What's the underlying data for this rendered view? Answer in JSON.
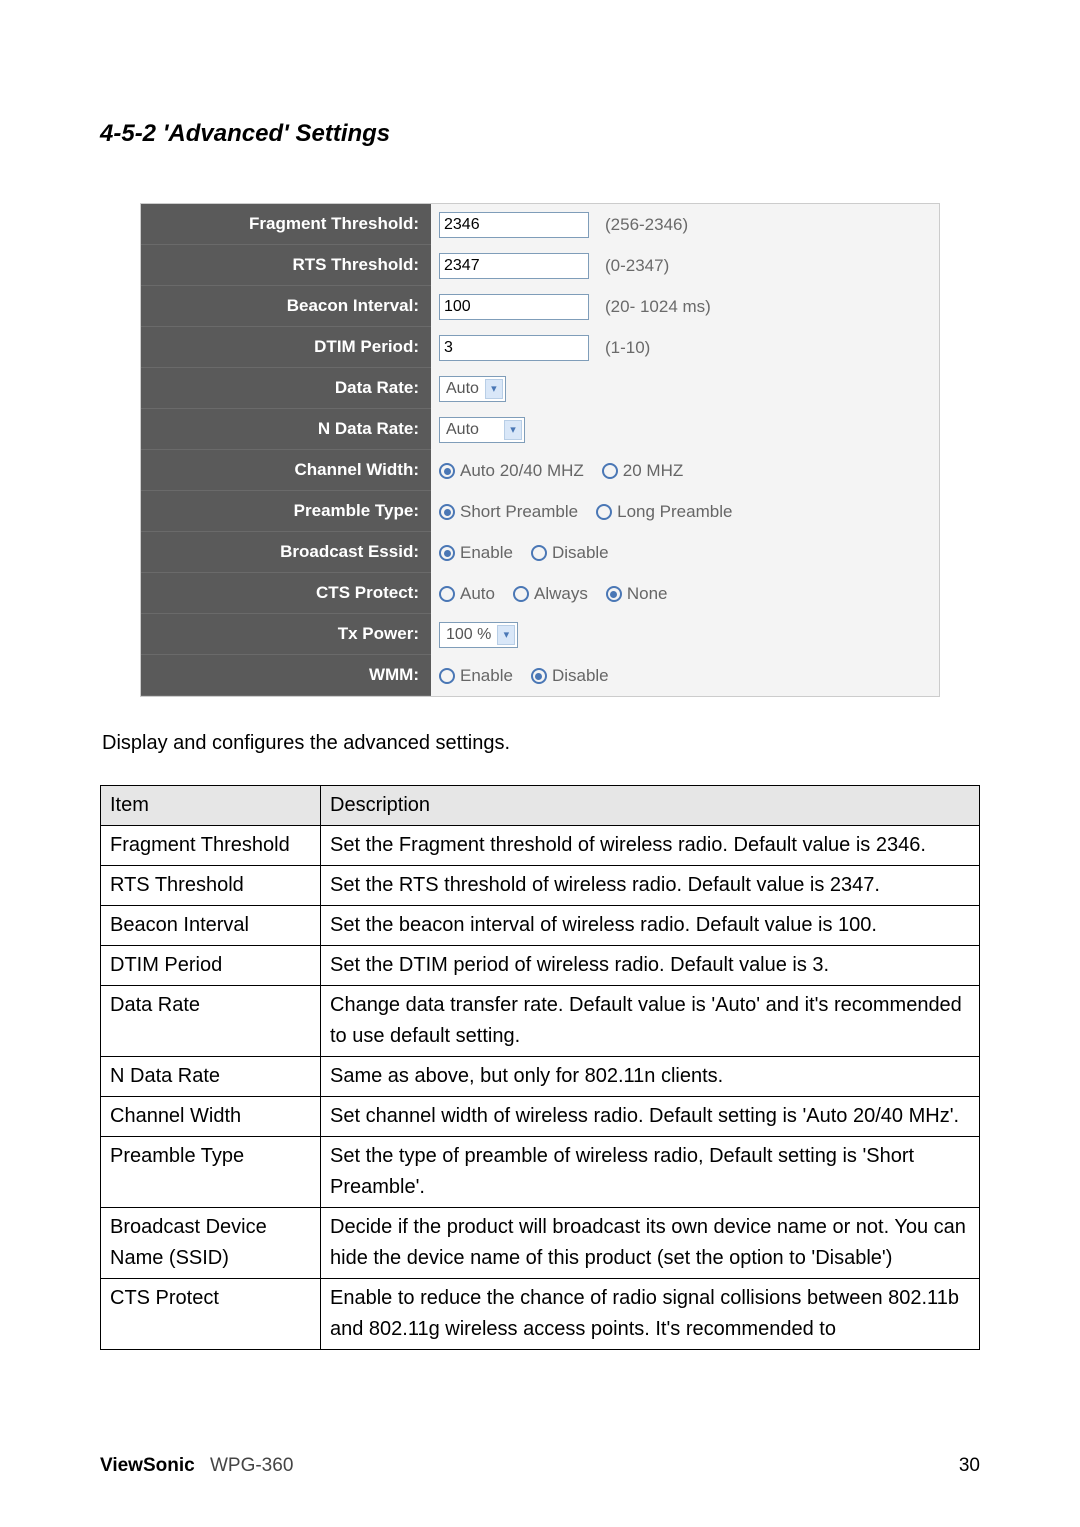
{
  "section_title": "4-5-2 'Advanced' Settings",
  "panel": {
    "fragment_threshold": {
      "label": "Fragment Threshold:",
      "value": "2346",
      "hint": "(256-2346)"
    },
    "rts_threshold": {
      "label": "RTS Threshold:",
      "value": "2347",
      "hint": "(0-2347)"
    },
    "beacon_interval": {
      "label": "Beacon Interval:",
      "value": "100",
      "hint": "(20- 1024 ms)"
    },
    "dtim_period": {
      "label": "DTIM Period:",
      "value": "3",
      "hint": "(1-10)"
    },
    "data_rate": {
      "label": "Data Rate:",
      "value": "Auto"
    },
    "n_data_rate": {
      "label": "N Data Rate:",
      "value": "Auto"
    },
    "channel_width": {
      "label": "Channel Width:",
      "opt1": "Auto 20/40 MHZ",
      "opt2": "20 MHZ"
    },
    "preamble_type": {
      "label": "Preamble Type:",
      "opt1": "Short Preamble",
      "opt2": "Long Preamble"
    },
    "broadcast_essid": {
      "label": "Broadcast Essid:",
      "opt1": "Enable",
      "opt2": "Disable"
    },
    "cts_protect": {
      "label": "CTS Protect:",
      "opt1": "Auto",
      "opt2": "Always",
      "opt3": "None"
    },
    "tx_power": {
      "label": "Tx Power:",
      "value": "100 %"
    },
    "wmm": {
      "label": "WMM:",
      "opt1": "Enable",
      "opt2": "Disable"
    }
  },
  "caption": "Display and configures the advanced settings.",
  "table": {
    "header": {
      "item": "Item",
      "desc": "Description"
    },
    "rows": [
      {
        "item": "Fragment Threshold",
        "desc": "Set the Fragment threshold of wireless radio.\nDefault value is 2346."
      },
      {
        "item": "RTS Threshold",
        "desc": "Set the RTS threshold of wireless radio. Default value is 2347."
      },
      {
        "item": "Beacon Interval",
        "desc": "Set the beacon interval of wireless radio. Default value is 100."
      },
      {
        "item": "DTIM Period",
        "desc": "Set the DTIM period of wireless radio. Default value is 3."
      },
      {
        "item": "Data Rate",
        "desc": "Change data transfer rate. Default value is 'Auto' and it's recommended to use default setting."
      },
      {
        "item": "N Data Rate",
        "desc": "Same as above, but only for 802.11n clients."
      },
      {
        "item": "Channel Width",
        "desc": "Set channel width of wireless radio. Default setting is 'Auto 20/40 MHz'."
      },
      {
        "item": "Preamble Type",
        "desc": "Set the type of preamble of wireless radio, Default setting is 'Short Preamble'."
      },
      {
        "item": "Broadcast Device Name (SSID)",
        "desc": "Decide if the product will broadcast its own device name or not. You can hide the device name of this product (set the option to 'Disable')"
      },
      {
        "item": "CTS Protect",
        "desc": "Enable to reduce the chance of radio signal collisions between 802.11b and 802.11g wireless access points. It's recommended to"
      }
    ]
  },
  "footer": {
    "brand": "ViewSonic",
    "model": "WPG-360",
    "page": "30"
  }
}
